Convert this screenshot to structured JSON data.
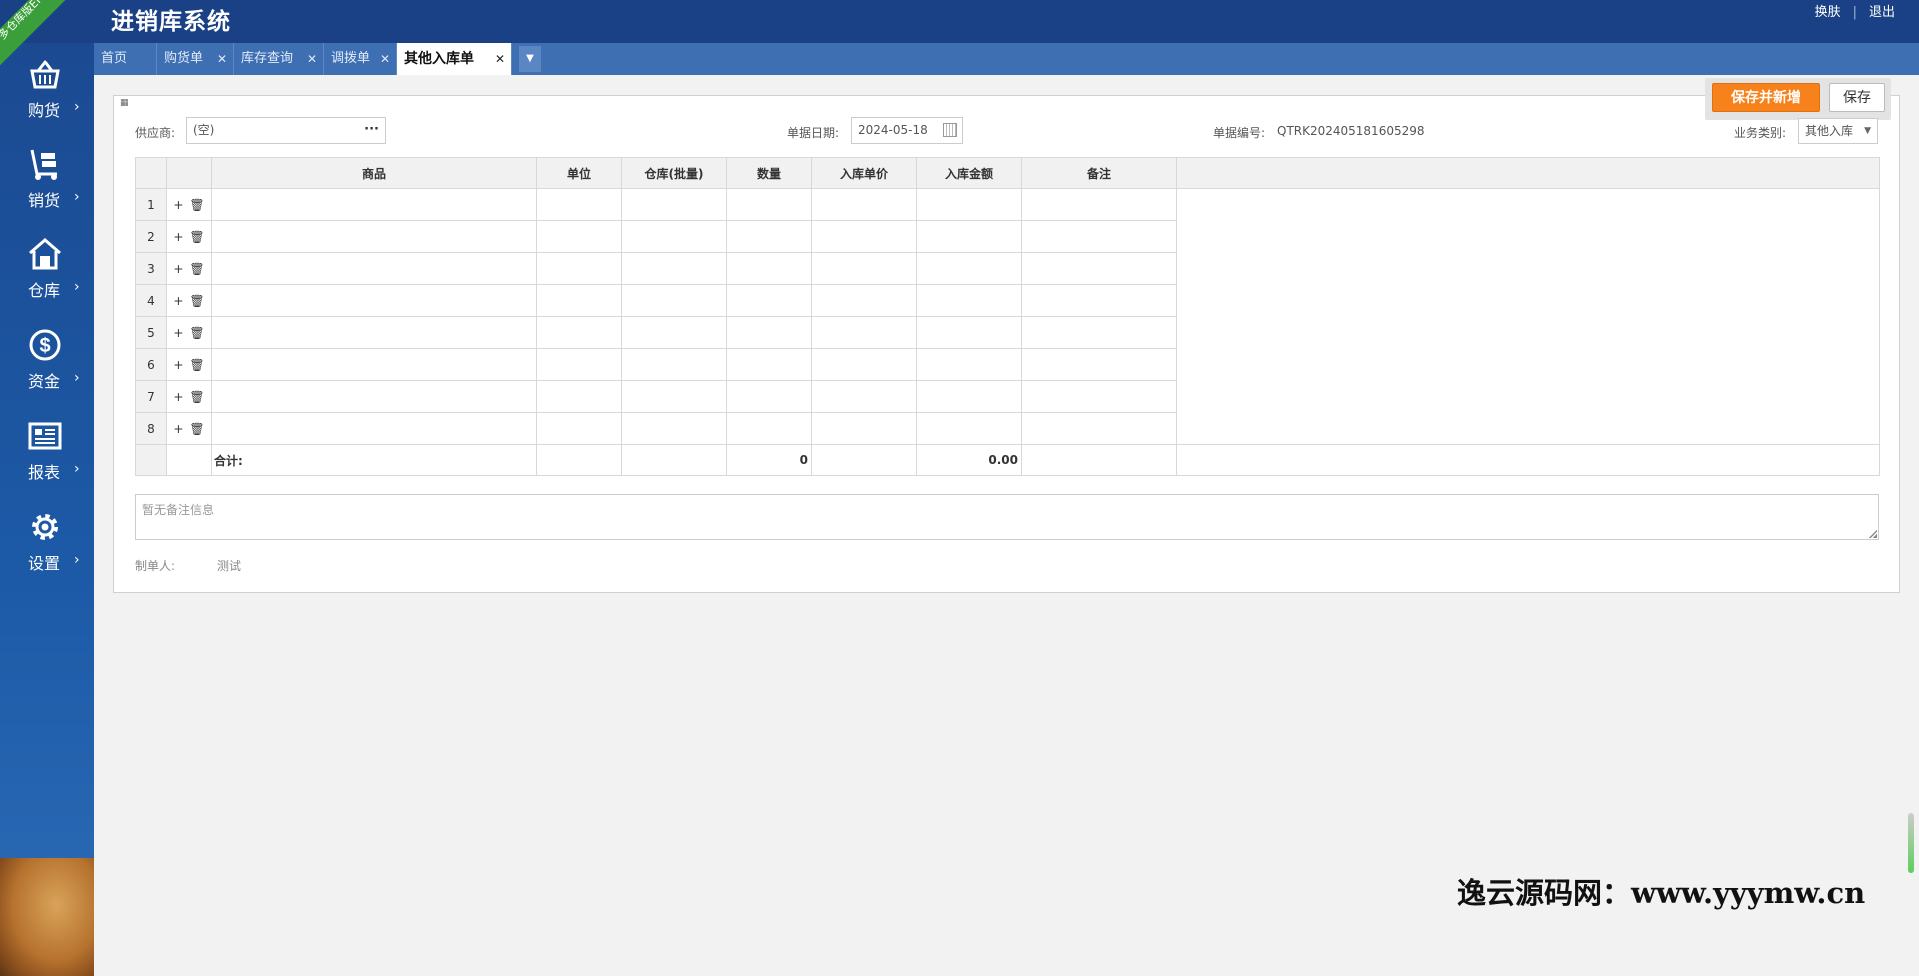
{
  "header": {
    "title": "进销库系统",
    "ribbon": "多仓库版ERP",
    "links": [
      "换肤",
      "退出"
    ]
  },
  "sidebar": {
    "items": [
      {
        "label": "购货",
        "icon": "basket-icon"
      },
      {
        "label": "销货",
        "icon": "hand-truck-icon"
      },
      {
        "label": "仓库",
        "icon": "warehouse-icon"
      },
      {
        "label": "资金",
        "icon": "dollar-icon"
      },
      {
        "label": "报表",
        "icon": "report-icon"
      },
      {
        "label": "设置",
        "icon": "gear-icon"
      }
    ]
  },
  "tabs": [
    {
      "label": "首页",
      "closable": false
    },
    {
      "label": "购货单",
      "closable": true
    },
    {
      "label": "库存查询",
      "closable": true
    },
    {
      "label": "调拨单",
      "closable": true
    },
    {
      "label": "其他入库单",
      "closable": true,
      "active": true
    }
  ],
  "actions": {
    "save_new": "保存并新增",
    "save": "保存"
  },
  "form": {
    "supplier_label": "供应商:",
    "supplier_value": "(空)",
    "date_label": "单据日期:",
    "date_value": "2024-05-18",
    "no_label": "单据编号:",
    "no_value": "QTRK202405181605298",
    "type_label": "业务类别:",
    "type_value": "其他入库"
  },
  "grid": {
    "columns": [
      "商品",
      "单位",
      "仓库(批量)",
      "数量",
      "入库单价",
      "入库金额",
      "备注"
    ],
    "rows": [
      1,
      2,
      3,
      4,
      5,
      6,
      7,
      8
    ],
    "total_label": "合计:",
    "total_qty": "0",
    "total_amount": "0.00"
  },
  "remark": {
    "placeholder": "暂无备注信息"
  },
  "footer": {
    "creator_label": "制单人:",
    "creator_value": "测试"
  },
  "watermark": "逸云源码网：www.yyymw.cn",
  "colors": {
    "header": "#1a4185",
    "tabbar": "#3e6fb3",
    "accent": "#f7821b"
  }
}
